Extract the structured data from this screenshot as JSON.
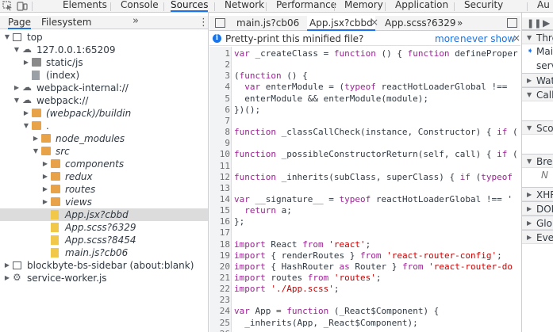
{
  "top_tabs": [
    "Elements",
    "Console",
    "Sources",
    "Network",
    "Performance",
    "Memory",
    "Application",
    "Security",
    "Au"
  ],
  "active_top_tab": "Sources",
  "navigator": {
    "tabs": [
      "Page",
      "Filesystem"
    ],
    "more": "»",
    "kebab": "⋮",
    "tree": [
      {
        "label": "top",
        "icon": "frame",
        "arrow": "down",
        "indent": 0
      },
      {
        "label": "127.0.0.1:65209",
        "icon": "cloud",
        "arrow": "down",
        "indent": 1
      },
      {
        "label": "static/js",
        "icon": "folder-grey",
        "arrow": "right",
        "indent": 2
      },
      {
        "label": "(index)",
        "icon": "file-grey",
        "arrow": "",
        "indent": 2
      },
      {
        "label": "webpack-internal://",
        "icon": "cloud",
        "arrow": "right",
        "indent": 1
      },
      {
        "label": "webpack://",
        "icon": "cloud",
        "arrow": "down",
        "indent": 1
      },
      {
        "label": "(webpack)/buildin",
        "icon": "folder",
        "arrow": "right",
        "indent": 2,
        "italic": true
      },
      {
        "label": ".",
        "icon": "folder",
        "arrow": "down",
        "indent": 2
      },
      {
        "label": "node_modules",
        "icon": "folder",
        "arrow": "right",
        "indent": 3,
        "italic": true
      },
      {
        "label": "src",
        "icon": "folder",
        "arrow": "down",
        "indent": 3,
        "italic": true
      },
      {
        "label": "components",
        "icon": "folder",
        "arrow": "right",
        "indent": 4,
        "italic": true
      },
      {
        "label": "redux",
        "icon": "folder",
        "arrow": "right",
        "indent": 4,
        "italic": true
      },
      {
        "label": "routes",
        "icon": "folder",
        "arrow": "right",
        "indent": 4,
        "italic": true
      },
      {
        "label": "views",
        "icon": "folder",
        "arrow": "right",
        "indent": 4,
        "italic": true
      },
      {
        "label": "App.jsx?cbbd",
        "icon": "file-yellow",
        "arrow": "",
        "indent": 4,
        "italic": true,
        "selected": true
      },
      {
        "label": "App.scss?6329",
        "icon": "file-yellow",
        "arrow": "",
        "indent": 4,
        "italic": true
      },
      {
        "label": "App.scss?8454",
        "icon": "file-yellow",
        "arrow": "",
        "indent": 4,
        "italic": true
      },
      {
        "label": "main.js?cb06",
        "icon": "file-yellow",
        "arrow": "",
        "indent": 4,
        "italic": true
      },
      {
        "label": "blockbyte-bs-sidebar (about:blank)",
        "icon": "frame",
        "arrow": "right",
        "indent": 0
      },
      {
        "label": "service-worker.js",
        "icon": "gear",
        "arrow": "right",
        "indent": 0
      }
    ]
  },
  "editor": {
    "tabs": [
      "main.js?cb06",
      "App.jsx?cbbd",
      "App.scss?6329"
    ],
    "active_tab": "App.jsx?cbbd",
    "tab_close": "×",
    "more": "»",
    "infobar": {
      "message": "Pretty-print this minified file?",
      "more_link": "more",
      "never_link": "never show",
      "close": "×"
    },
    "lines": [
      {
        "n": "1",
        "segs": [
          [
            "kw",
            "var "
          ],
          [
            "",
            "_createClass = "
          ],
          [
            "kw",
            "function"
          ],
          [
            "",
            " () { "
          ],
          [
            "kw",
            "function"
          ],
          [
            "",
            " defineProper"
          ]
        ]
      },
      {
        "n": "2",
        "segs": []
      },
      {
        "n": "3",
        "segs": [
          [
            "",
            "("
          ],
          [
            "kw",
            "function"
          ],
          [
            "",
            " () {"
          ]
        ]
      },
      {
        "n": "4",
        "segs": [
          [
            "",
            "  "
          ],
          [
            "kw",
            "var "
          ],
          [
            "",
            "enterModule = ("
          ],
          [
            "kw",
            "typeof"
          ],
          [
            "",
            " reactHotLoaderGlobal !=="
          ]
        ]
      },
      {
        "n": "5",
        "segs": [
          [
            "",
            "  enterModule && enterModule(module);"
          ]
        ]
      },
      {
        "n": "6",
        "segs": [
          [
            "",
            "})();"
          ]
        ]
      },
      {
        "n": "7",
        "segs": []
      },
      {
        "n": "8",
        "segs": [
          [
            "kw",
            "function"
          ],
          [
            "",
            " _classCallCheck(instance, Constructor) { "
          ],
          [
            "kw",
            "if"
          ],
          [
            "",
            " ("
          ]
        ]
      },
      {
        "n": "9",
        "segs": []
      },
      {
        "n": "10",
        "segs": [
          [
            "kw",
            "function"
          ],
          [
            "",
            " _possibleConstructorReturn(self, call) { "
          ],
          [
            "kw",
            "if"
          ],
          [
            "",
            " ("
          ]
        ]
      },
      {
        "n": "11",
        "segs": []
      },
      {
        "n": "12",
        "segs": [
          [
            "kw",
            "function"
          ],
          [
            "",
            " _inherits(subClass, superClass) { "
          ],
          [
            "kw",
            "if"
          ],
          [
            "",
            " ("
          ],
          [
            "kw",
            "typeof"
          ]
        ]
      },
      {
        "n": "13",
        "segs": []
      },
      {
        "n": "14",
        "segs": [
          [
            "kw",
            "var "
          ],
          [
            "",
            "__signature__ = "
          ],
          [
            "kw",
            "typeof"
          ],
          [
            "",
            " reactHotLoaderGlobal !== '"
          ]
        ]
      },
      {
        "n": "15",
        "segs": [
          [
            "",
            "  "
          ],
          [
            "kw",
            "return"
          ],
          [
            "",
            " a;"
          ]
        ]
      },
      {
        "n": "16",
        "segs": [
          [
            "",
            "};"
          ]
        ]
      },
      {
        "n": "17",
        "segs": []
      },
      {
        "n": "18",
        "segs": [
          [
            "kw",
            "import"
          ],
          [
            "",
            " React "
          ],
          [
            "kw",
            "from"
          ],
          [
            "",
            " "
          ],
          [
            "str",
            "'react'"
          ],
          [
            "",
            ";"
          ]
        ]
      },
      {
        "n": "19",
        "segs": [
          [
            "kw",
            "import"
          ],
          [
            "",
            " { renderRoutes } "
          ],
          [
            "kw",
            "from"
          ],
          [
            "",
            " "
          ],
          [
            "str",
            "'react-router-config'"
          ],
          [
            "",
            ";"
          ]
        ]
      },
      {
        "n": "20",
        "segs": [
          [
            "kw",
            "import"
          ],
          [
            "",
            " { HashRouter "
          ],
          [
            "kw",
            "as"
          ],
          [
            "",
            " Router } "
          ],
          [
            "kw",
            "from"
          ],
          [
            "",
            " "
          ],
          [
            "str",
            "'react-router-do"
          ]
        ]
      },
      {
        "n": "21",
        "segs": [
          [
            "kw",
            "import"
          ],
          [
            "",
            " routes "
          ],
          [
            "kw",
            "from"
          ],
          [
            "",
            " "
          ],
          [
            "str",
            "'routes'"
          ],
          [
            "",
            ";"
          ]
        ]
      },
      {
        "n": "22",
        "segs": [
          [
            "kw",
            "import"
          ],
          [
            "",
            " "
          ],
          [
            "str",
            "'./App.scss'"
          ],
          [
            "",
            ";"
          ]
        ]
      },
      {
        "n": "23",
        "segs": []
      },
      {
        "n": "24",
        "segs": [
          [
            "kw",
            "var "
          ],
          [
            "",
            "App = "
          ],
          [
            "kw",
            "function"
          ],
          [
            "",
            " (_React$Component) {"
          ]
        ]
      },
      {
        "n": "25",
        "segs": [
          [
            "",
            "  _inherits(App, _React$Component);"
          ]
        ]
      },
      {
        "n": "26",
        "segs": []
      }
    ]
  },
  "right_panel": {
    "items": [
      {
        "label": "Threa",
        "type": "header",
        "arrow": "down"
      },
      {
        "label": "Mai",
        "type": "thread-main",
        "arrow": "➧"
      },
      {
        "label": "serv",
        "type": "thread",
        "arrow": ""
      },
      {
        "label": "Watc",
        "type": "header",
        "arrow": "right"
      },
      {
        "label": "Call",
        "type": "header",
        "arrow": "down"
      },
      {
        "label": "",
        "type": "blank",
        "arrow": ""
      },
      {
        "label": "Scop",
        "type": "header",
        "arrow": "down"
      },
      {
        "label": "",
        "type": "blank",
        "arrow": ""
      },
      {
        "label": "Brea",
        "type": "header",
        "arrow": "down"
      },
      {
        "label": "N",
        "type": "italic",
        "arrow": ""
      },
      {
        "label": "XHR",
        "type": "header",
        "arrow": "right"
      },
      {
        "label": "DOM",
        "type": "header",
        "arrow": "right"
      },
      {
        "label": "Glob",
        "type": "header",
        "arrow": "right"
      },
      {
        "label": "Even",
        "type": "header",
        "arrow": "right"
      }
    ]
  }
}
